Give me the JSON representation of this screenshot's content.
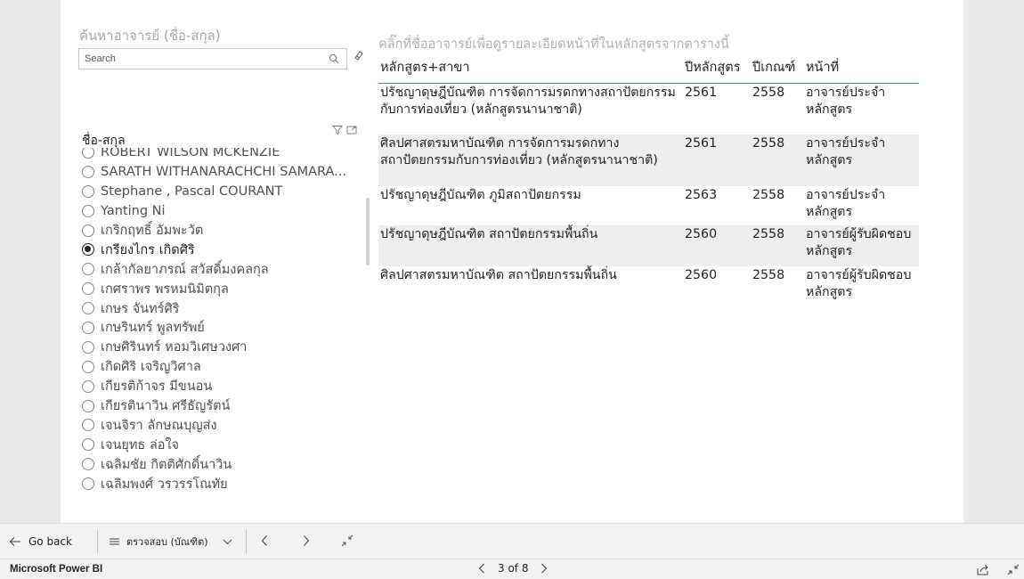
{
  "search": {
    "title": "ค้นหาอาจารย์ (ชื่อ-สกุล)",
    "placeholder": "Search",
    "value": ""
  },
  "slicer": {
    "header": "ชื่อ-สกุล",
    "items": [
      {
        "label": "ROBERT WILSON MCKENZIE",
        "selected": false
      },
      {
        "label": "SARATH WITHANARACHCHI SAMARA...",
        "selected": false
      },
      {
        "label": "Stephane , Pascal COURANT",
        "selected": false
      },
      {
        "label": "Yanting Ni",
        "selected": false
      },
      {
        "label": "เกริกฤทธิ์ อัมพะวัต",
        "selected": false
      },
      {
        "label": "เกรียงไกร เกิดศิริ",
        "selected": true
      },
      {
        "label": "เกล้ากัลยาภรณ์ สวัสดิ์มงคลกุล",
        "selected": false
      },
      {
        "label": "เกศราพร พรหมนิมิตกุล",
        "selected": false
      },
      {
        "label": "เกษร จันทร์ศิริ",
        "selected": false
      },
      {
        "label": "เกษรินทร์ พูลทรัพย์",
        "selected": false
      },
      {
        "label": "เกษศิรินทร์ หอมวิเศษวงศา",
        "selected": false
      },
      {
        "label": "เกิดศิริ เจริญวิศาล",
        "selected": false
      },
      {
        "label": "เกียรติก้าจร มีขนอน",
        "selected": false
      },
      {
        "label": "เกียรตินาวิน ศรีธัญรัตน์",
        "selected": false
      },
      {
        "label": "เจนจิรา ลักษณบุญส่ง",
        "selected": false
      },
      {
        "label": "เจนยุทธ ล่อใจ",
        "selected": false
      },
      {
        "label": "เฉลิมชัย กิตติศักดิ์นาวิน",
        "selected": false
      },
      {
        "label": "เฉลิมพงศ์ วรวรรโณทัย",
        "selected": false
      }
    ]
  },
  "table": {
    "title": "คลิ๊กที่ชื่ออาจารย์เพื่อดูรายละเอียดหน้าที่ในหลักสูตรจากตารางนี้",
    "headers": [
      "หลักสูตร+สาขา",
      "ปีหลักสูตร",
      "ปีเกณฑ์",
      "หน้าที่"
    ],
    "rows": [
      [
        "ปรัชญาดุษฎีบัณฑิต การจัดการมรดกทางสถาปัตยกรรมกับการท่องเที่ยว (หลักสูตรนานาชาติ)",
        "2561",
        "2558",
        "อาจารย์ประจำหลักสูตร"
      ],
      [
        "ศิลปศาสตรมหาบัณฑิต การจัดการมรดกทางสถาปัตยกรรมกับการท่องเที่ยว (หลักสูตรนานาชาติ)",
        "2561",
        "2558",
        "อาจารย์ประจำหลักสูตร"
      ],
      [
        "ปรัชญาดุษฎีบัณฑิต ภูมิสถาปัตยกรรม",
        "2563",
        "2558",
        "อาจารย์ประจำหลักสูตร"
      ],
      [
        "ปรัชญาดุษฎีบัณฑิต สถาปัตยกรรมพื้นถิ่น",
        "2560",
        "2558",
        "อาจารย์ผู้รับผิดชอบหลักสูตร"
      ],
      [
        "ศิลปศาสตรมหาบัณฑิต สถาปัตยกรรมพื้นถิ่น",
        "2560",
        "2558",
        "อาจารย์ผู้รับผิดชอบหลักสูตร"
      ]
    ]
  },
  "nav": {
    "back_label": "Go back",
    "page_name": "ตรวจสอบ (บัณฑิต)"
  },
  "footer": {
    "brand": "Microsoft Power BI",
    "pager": "3 of 8"
  },
  "colors": {
    "accent": "#1aa19c",
    "alt_row": "#eeeeee",
    "chrome": "#f3f2f1"
  }
}
